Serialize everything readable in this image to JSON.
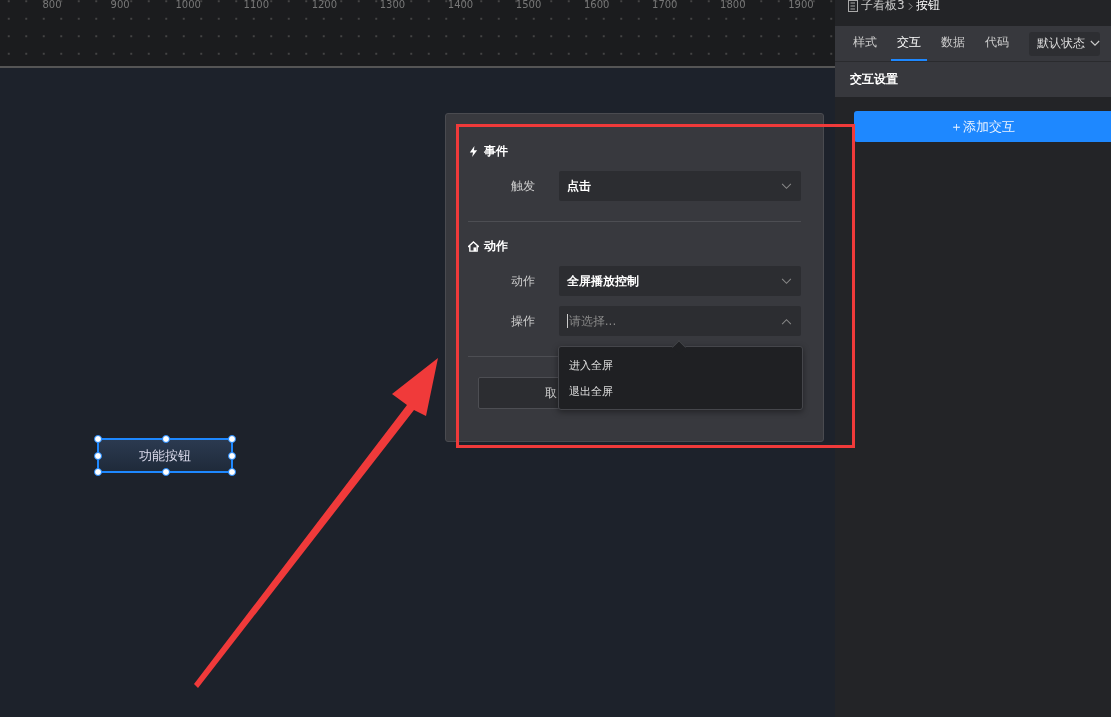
{
  "ruler": {
    "ticks": [
      "800",
      "900",
      "1000",
      "1100",
      "1200",
      "1300",
      "1400",
      "1500",
      "1600",
      "1700",
      "1800",
      "1900"
    ]
  },
  "canvas": {
    "widget": {
      "label": "功能按钮",
      "selected": true
    }
  },
  "dialog": {
    "sections": [
      {
        "kind": "event",
        "title": "事件",
        "fields": [
          {
            "label": "触发",
            "value": "点击",
            "open": false
          }
        ]
      },
      {
        "kind": "action",
        "title": "动作",
        "fields": [
          {
            "label": "动作",
            "value": "全屏播放控制",
            "open": false
          },
          {
            "label": "操作",
            "placeholder": "请选择...",
            "open": true,
            "options": [
              "进入全屏",
              "退出全屏"
            ]
          }
        ]
      }
    ],
    "buttons": [
      "取"
    ]
  },
  "panel": {
    "breadcrumb": [
      "子看板3",
      "按钮"
    ],
    "tabs": [
      {
        "label": "样式",
        "selected": false
      },
      {
        "label": "交互",
        "selected": true
      },
      {
        "label": "数据",
        "selected": false
      },
      {
        "label": "代码",
        "selected": false
      }
    ],
    "state_select": "默认状态",
    "section_title": "交互设置",
    "add_button": "＋添加交互"
  }
}
